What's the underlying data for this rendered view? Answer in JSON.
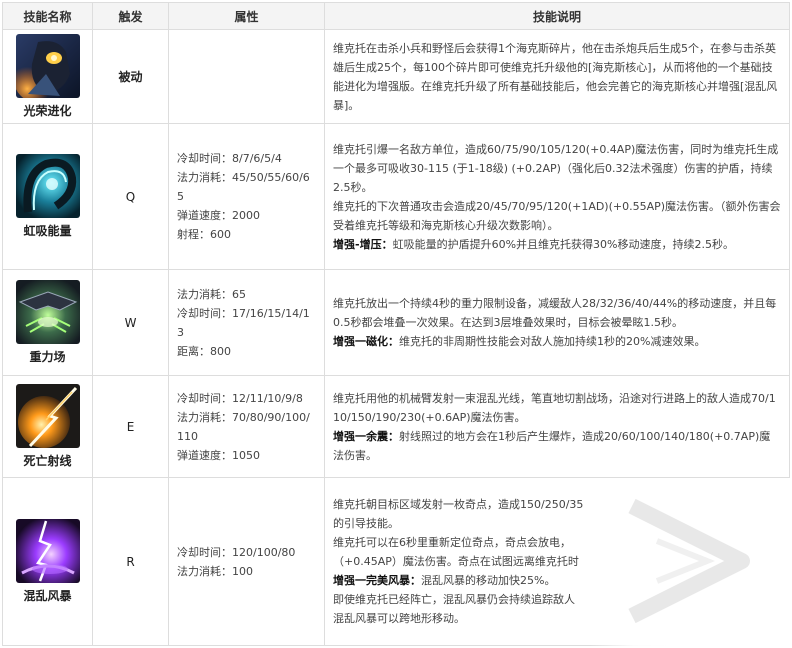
{
  "headers": {
    "skill": "技能名称",
    "trigger": "触发",
    "attributes": "属性",
    "description": "技能说明"
  },
  "rows": [
    {
      "name": "光荣进化",
      "icon": "glorious-evolution-icon",
      "trigger": "被动",
      "attributes": [],
      "paragraphs": [
        {
          "bold": "",
          "text": "维克托在击杀小兵和野怪后会获得1个海克斯碎片，他在击杀炮兵后生成5个，在参与击杀英雄后生成25个，每100个碎片即可使维克托升级他的[海克斯核心]，从而将他的一个基础技能进化为增强版。在维克托升级了所有基础技能后，他会完善它的海克斯核心并增强[混乱风暴]。"
        }
      ]
    },
    {
      "name": "虹吸能量",
      "icon": "siphon-power-icon",
      "trigger": "Q",
      "attributes": [
        "冷却时间：8/7/6/5/4",
        "法力消耗：45/50/55/60/65",
        "弹道速度：2000",
        "射程：600"
      ],
      "paragraphs": [
        {
          "bold": "",
          "text": "维克托引爆一名敌方单位，造成60/75/90/105/120(+0.4AP)魔法伤害，同时为维克托生成一个最多可吸收30-115 (于1-18级) (+0.2AP)（强化后0.32法术强度）伤害的护盾，持续2.5秒。"
        },
        {
          "bold": "",
          "text": "维克托的下次普通攻击会造成20/45/70/95/120(+1AD)(+0.55AP)魔法伤害。（额外伤害会受着维克托等级和海克斯核心升级次数影响）。"
        },
        {
          "bold": "增强-增压：",
          "text": "虹吸能量的护盾提升60%并且维克托获得30%移动速度，持续2.5秒。"
        }
      ]
    },
    {
      "name": "重力场",
      "icon": "gravity-field-icon",
      "trigger": "W",
      "attributes": [
        "法力消耗：65",
        "冷却时间：17/16/15/14/13",
        "距离：800"
      ],
      "paragraphs": [
        {
          "bold": "",
          "text": "维克托放出一个持续4秒的重力限制设备，减缓敌人28/32/36/40/44%的移动速度，并且每0.5秒都会堆叠一次效果。在达到3层堆叠效果时，目标会被晕眩1.5秒。"
        },
        {
          "bold": "增强一磁化：",
          "text": "维克托的非周期性技能会对敌人施加持续1秒的20%减速效果。"
        }
      ]
    },
    {
      "name": "死亡射线",
      "icon": "death-ray-icon",
      "trigger": "E",
      "attributes": [
        "冷却时间：12/11/10/9/8",
        "法力消耗：70/80/90/100/110",
        "弹道速度：1050"
      ],
      "paragraphs": [
        {
          "bold": "",
          "text": "维克托用他的机械臂发射一束混乱光线，笔直地切割战场，沿途对行进路上的敌人造成70/110/150/190/230(+0.6AP)魔法伤害。"
        },
        {
          "bold": "增强一余震：",
          "text": "射线照过的地方会在1秒后产生爆炸，造成20/60/100/140/180(+0.7AP)魔法伤害。"
        }
      ]
    },
    {
      "name": "混乱风暴",
      "icon": "chaos-storm-icon",
      "trigger": "R",
      "attributes": [
        "冷却时间：120/100/80",
        "法力消耗：100"
      ],
      "paragraphs": [
        {
          "bold": "",
          "text": "维克托朝目标区域发射一枚奇点，造成150/250/35"
        },
        {
          "bold": "",
          "text": "的引导技能。"
        },
        {
          "bold": "",
          "text": "维克托可以在6秒里重新定位奇点，奇点会放电，"
        },
        {
          "bold": "",
          "text": "（+0.45AP）魔法伤害。奇点在试图远离维克托时"
        },
        {
          "bold": "增强一完美风暴：",
          "text": "混乱风暴的移动加快25%。"
        },
        {
          "bold": "",
          "text": "即使维克托已经阵亡，混乱风暴仍会持续追踪敌人"
        },
        {
          "bold": "",
          "text": "混乱风暴可以跨地形移动。"
        }
      ]
    }
  ]
}
